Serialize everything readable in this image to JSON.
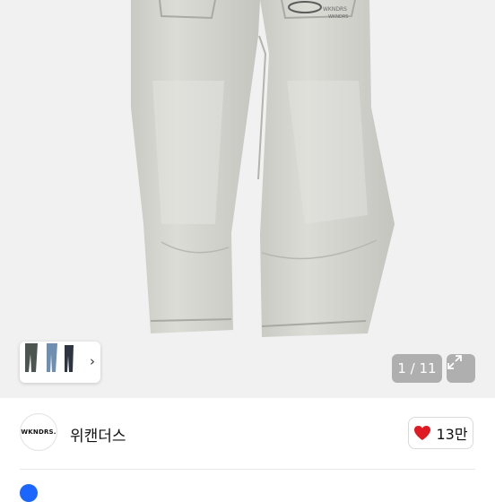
{
  "gallery": {
    "counter": "1 / 11",
    "thumbnail_more": "›",
    "expand_icon": "expand-icon"
  },
  "shop": {
    "logo_text": "WKNDRS.",
    "name": "위캔더스",
    "like_count": "13만",
    "like_color": "#e01a22"
  },
  "info": {
    "text": "",
    "accent_color": "#1a66ff"
  }
}
